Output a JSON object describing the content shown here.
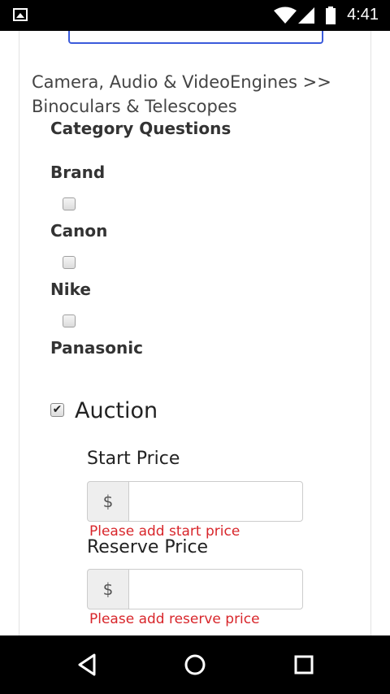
{
  "status_bar": {
    "time": "4:41"
  },
  "breadcrumb": "Camera, Audio & VideoEngines >> Binoculars & Telescopes",
  "category_section": {
    "title": "Category Questions",
    "question": "Brand",
    "options": [
      "Canon",
      "Nike",
      "Panasonic"
    ]
  },
  "auction": {
    "label": "Auction",
    "checked": true,
    "start_price": {
      "label": "Start Price",
      "currency": "$",
      "error": "Please add start price"
    },
    "reserve_price": {
      "label": "Reserve Price",
      "currency": "$",
      "error": "Please add reserve price"
    }
  }
}
